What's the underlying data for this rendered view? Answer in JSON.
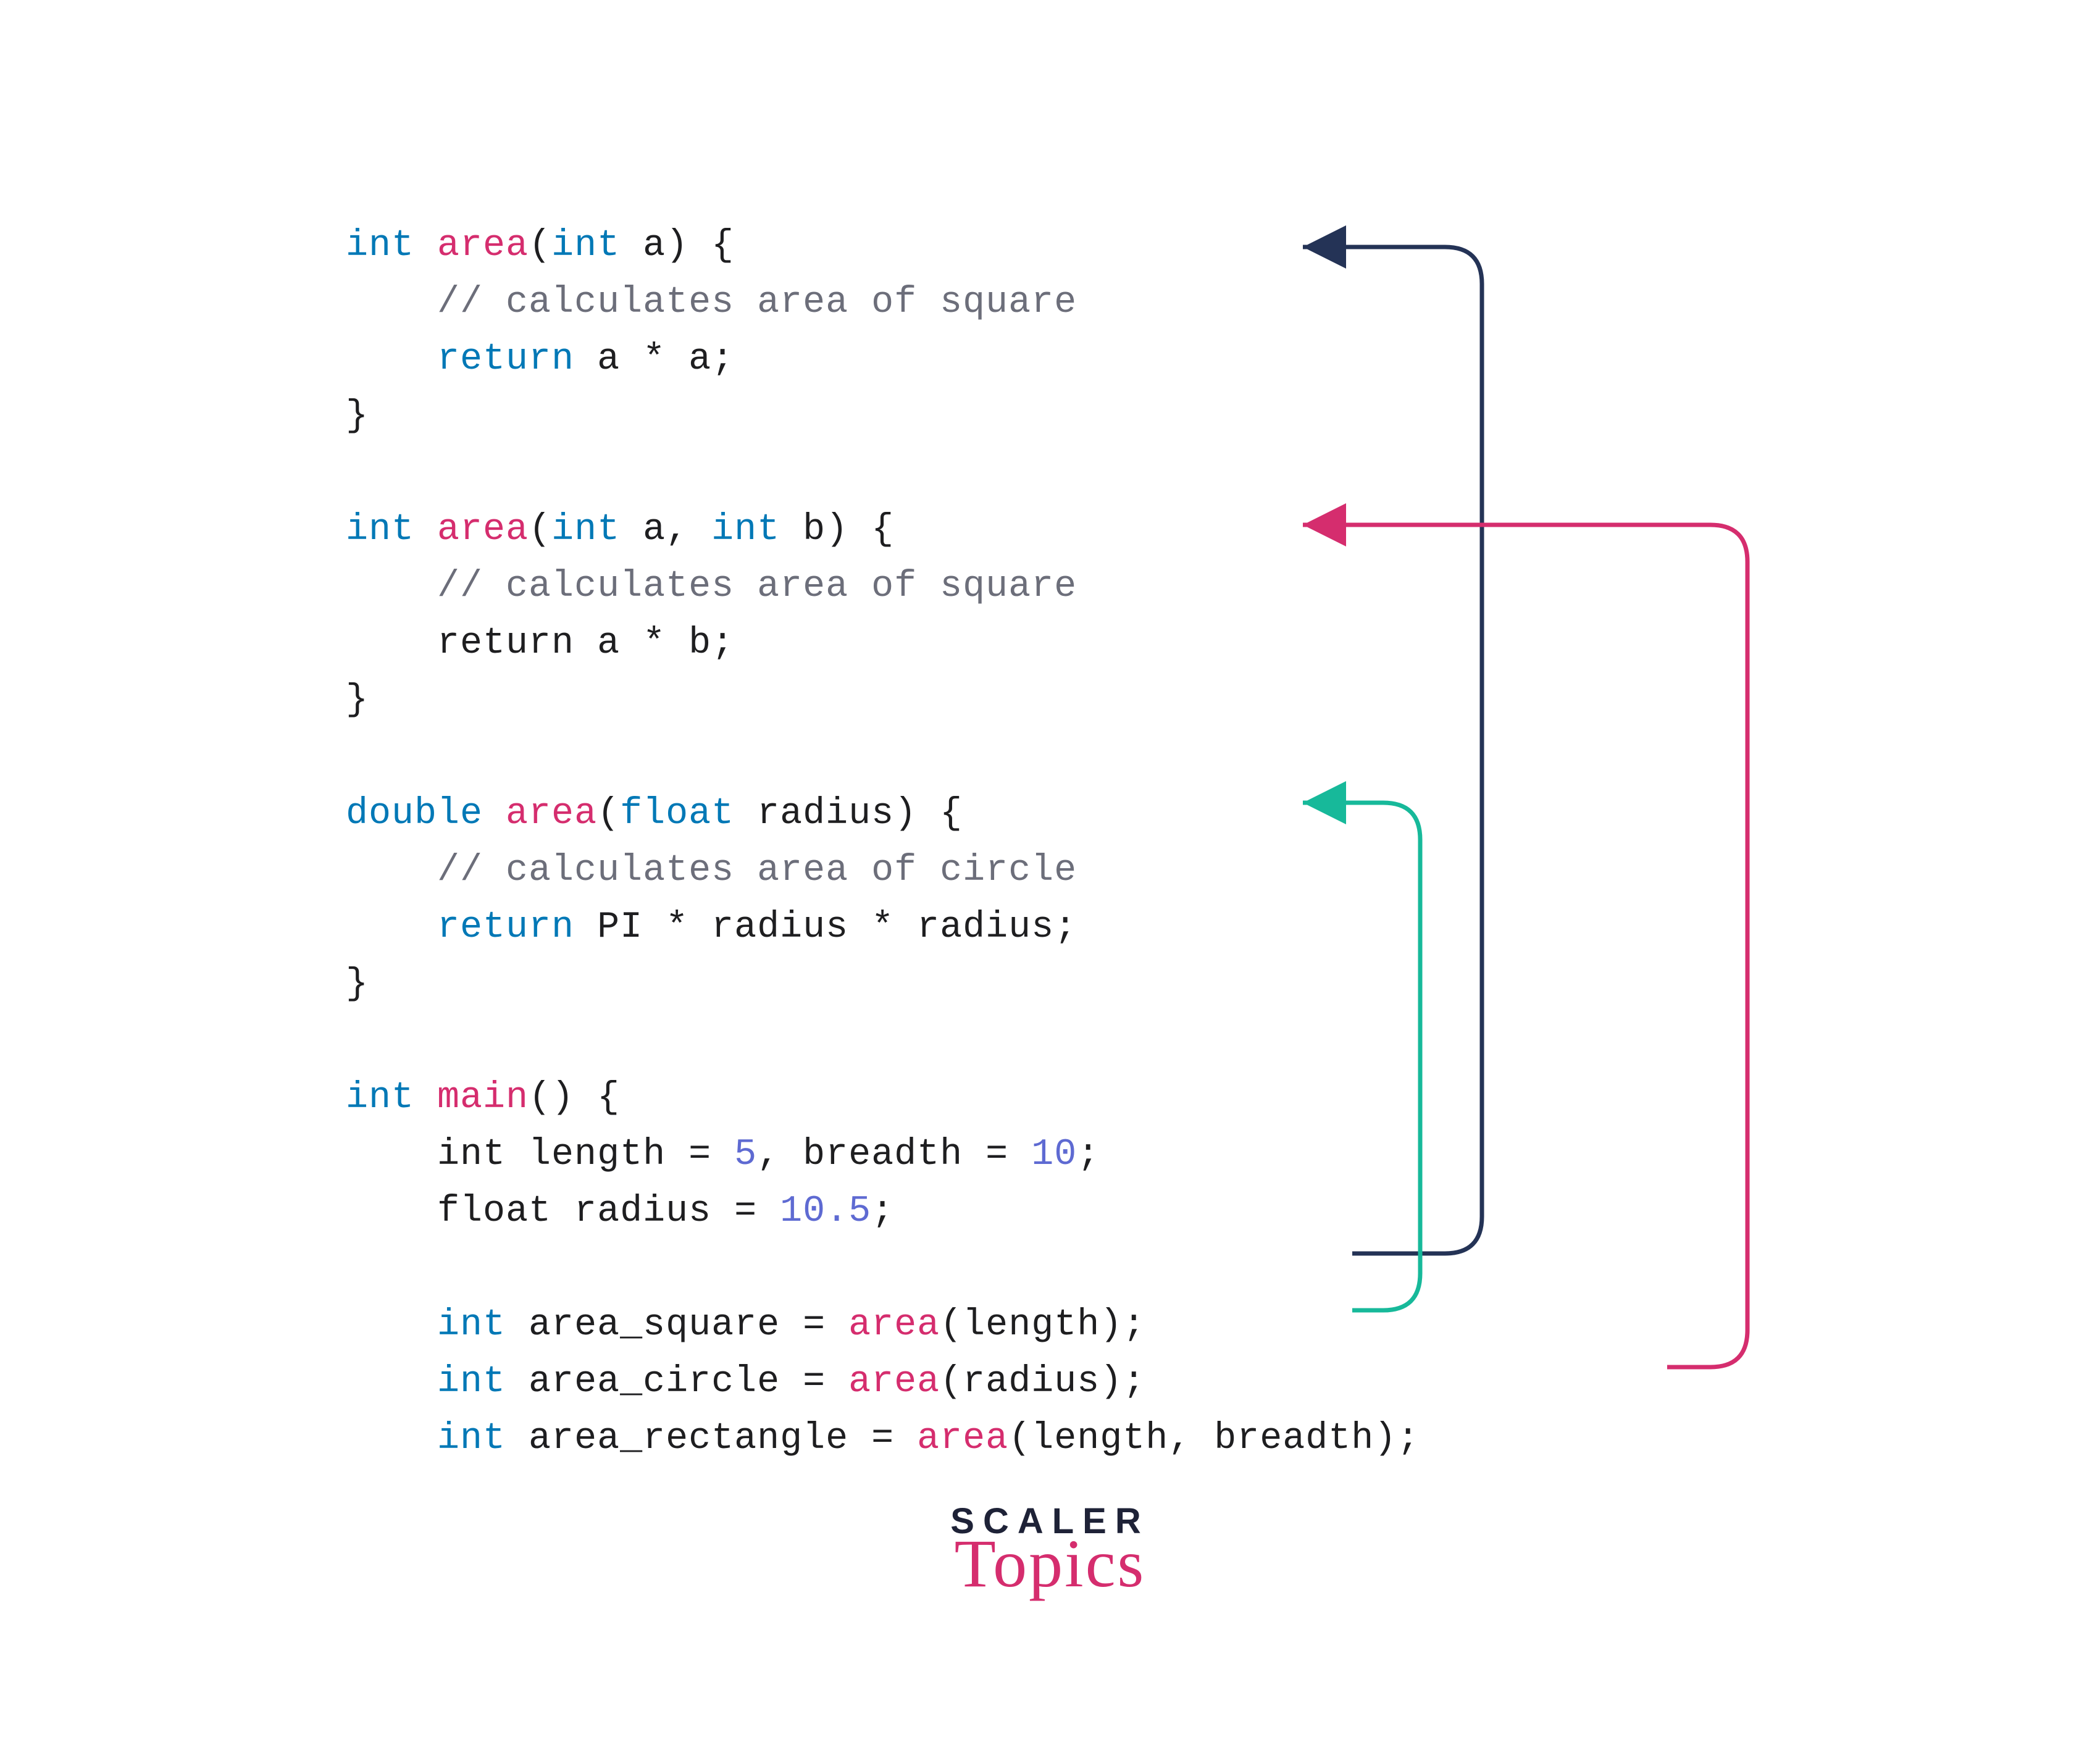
{
  "code": {
    "fn1": {
      "sig_pre": "int ",
      "sig_name": "area",
      "sig_post": "(int a) {",
      "comment": "    // calculates area of square",
      "ret_pre": "    return ",
      "ret_expr": "a * a;",
      "close": "}"
    },
    "fn2": {
      "sig_pre": "int ",
      "sig_name": "area",
      "sig_post": "(int a, int b) {",
      "comment": "    // calculates area of square",
      "ret_pre": "    return ",
      "ret_expr": "a * b;",
      "close": "}"
    },
    "fn3": {
      "sig_pre": "double ",
      "sig_name": "area",
      "sig_post": "(float radius) {",
      "comment": "    // calculates area of circle",
      "ret_pre": "    return ",
      "ret_expr": "PI * radius * radius;",
      "close": "}"
    },
    "main": {
      "sig_pre": "int ",
      "sig_name": "main",
      "sig_post": "() {",
      "decl1_pre": "    int length = ",
      "decl1_num1": "5",
      "decl1_mid": ", breadth = ",
      "decl1_num2": "10",
      "decl1_end": ";",
      "decl2_pre": "    float radius = ",
      "decl2_num": "10.5",
      "decl2_end": ";",
      "call1_pre": "    int",
      "call1_mid": " area_square = ",
      "call1_fn": "area",
      "call1_end": "(length);",
      "call2_pre": "    int",
      "call2_mid": " area_circle = ",
      "call2_fn": "area",
      "call2_end": "(radius);",
      "call3_pre": "    int",
      "call3_mid": " area_rectangle = ",
      "call3_fn": "area",
      "call3_end": "(length, breadth);"
    }
  },
  "logo": {
    "top": "SCALER",
    "bottom": "Topics"
  },
  "arrows": {
    "colors": {
      "square": "#243356",
      "rectangle": "#d52d6e",
      "circle": "#17b99a"
    }
  }
}
